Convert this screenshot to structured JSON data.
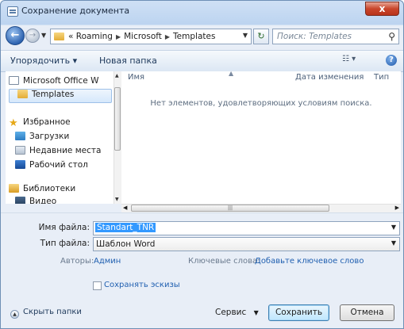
{
  "window": {
    "title": "Сохранение документа",
    "close_label": "x"
  },
  "address": {
    "overflow": "«",
    "crumbs": [
      "Roaming",
      "Microsoft",
      "Templates"
    ],
    "search_placeholder": "Поиск: Templates"
  },
  "toolbar": {
    "organize_label": "Упорядочить ▾",
    "new_folder_label": "Новая папка",
    "view_label": "☷ ▾",
    "help_label": "?"
  },
  "nav": {
    "items": [
      {
        "label": "Microsoft Office W",
        "icon": "office-icon"
      },
      {
        "label": "Templates",
        "icon": "folder-icon",
        "selected": true
      },
      {
        "label": "Избранное",
        "icon": "star-icon"
      },
      {
        "label": "Загрузки",
        "icon": "downloads-icon"
      },
      {
        "label": "Недавние места",
        "icon": "recent-places-icon"
      },
      {
        "label": "Рабочий стол",
        "icon": "desktop-icon"
      },
      {
        "label": "Библиотеки",
        "icon": "libraries-icon"
      },
      {
        "label": "Видео",
        "icon": "video-icon"
      }
    ]
  },
  "content": {
    "columns": [
      "Имя",
      "Дата изменения",
      "Тип"
    ],
    "empty_message": "Нет элементов, удовлетворяющих условиям поиска."
  },
  "form": {
    "filename_label": "Имя файла:",
    "filename_value": "Standart_TNR",
    "filetype_label": "Тип файла:",
    "filetype_value": "Шаблон Word",
    "authors_label": "Авторы:",
    "authors_value": "Админ",
    "keywords_label": "Ключевые слова:",
    "keywords_value": "Добавьте ключевое слово",
    "thumbnails_label": "Сохранять эскизы",
    "hide_folders_label": "Скрыть папки",
    "service_label": "Сервис",
    "save_label": "Сохранить",
    "cancel_label": "Отмена"
  }
}
